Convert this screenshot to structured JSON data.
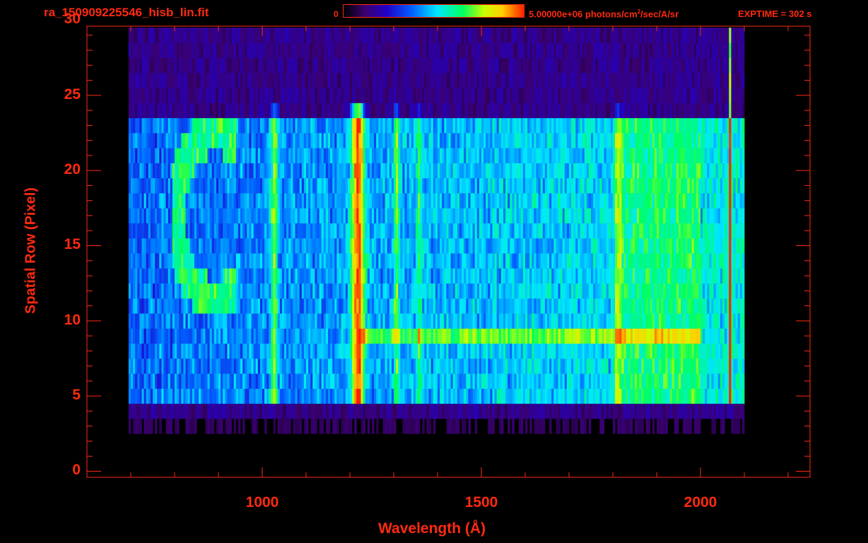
{
  "header": {
    "file_name": "ra_150909225546_hisb_lin.fit",
    "colorbar_min": "0",
    "colorbar_max_prefix": "5.00000e+06 photons/cm",
    "colorbar_max_exp": "2",
    "colorbar_max_suffix": "/sec/A/sr",
    "exptime": "EXPTIME = 302 s"
  },
  "colors": {
    "axis": "#ff2a10",
    "background": "#000000",
    "colormap": [
      "#000000",
      "#3a0070",
      "#2000c8",
      "#0060ff",
      "#00e8ff",
      "#00ff60",
      "#c8ff00",
      "#ffd000",
      "#ff2000"
    ]
  },
  "chart_data": {
    "type": "heatmap",
    "title": "ra_150909225546_hisb_lin.fit",
    "xlabel": "Wavelength (Å)",
    "ylabel": "Spatial Row (Pixel)",
    "xlim": [
      600,
      2250
    ],
    "ylim": [
      -0.4,
      29.6
    ],
    "x_ticks": [
      1000,
      1500,
      2000
    ],
    "y_ticks": [
      0,
      5,
      10,
      15,
      20,
      25,
      30
    ],
    "x_minor_step": 100,
    "y_minor_step": 1,
    "colorbar": {
      "min": 0,
      "max": 5000000,
      "units": "photons/cm^2/sec/A/sr"
    },
    "data_extent": {
      "x": [
        695,
        2100
      ],
      "y": [
        3,
        30
      ]
    },
    "emission_lines_angstrom": [
      1025,
      1216,
      1304,
      1356,
      1810,
      2065
    ],
    "bright_band_rows": [
      5,
      24
    ],
    "grid": false
  }
}
